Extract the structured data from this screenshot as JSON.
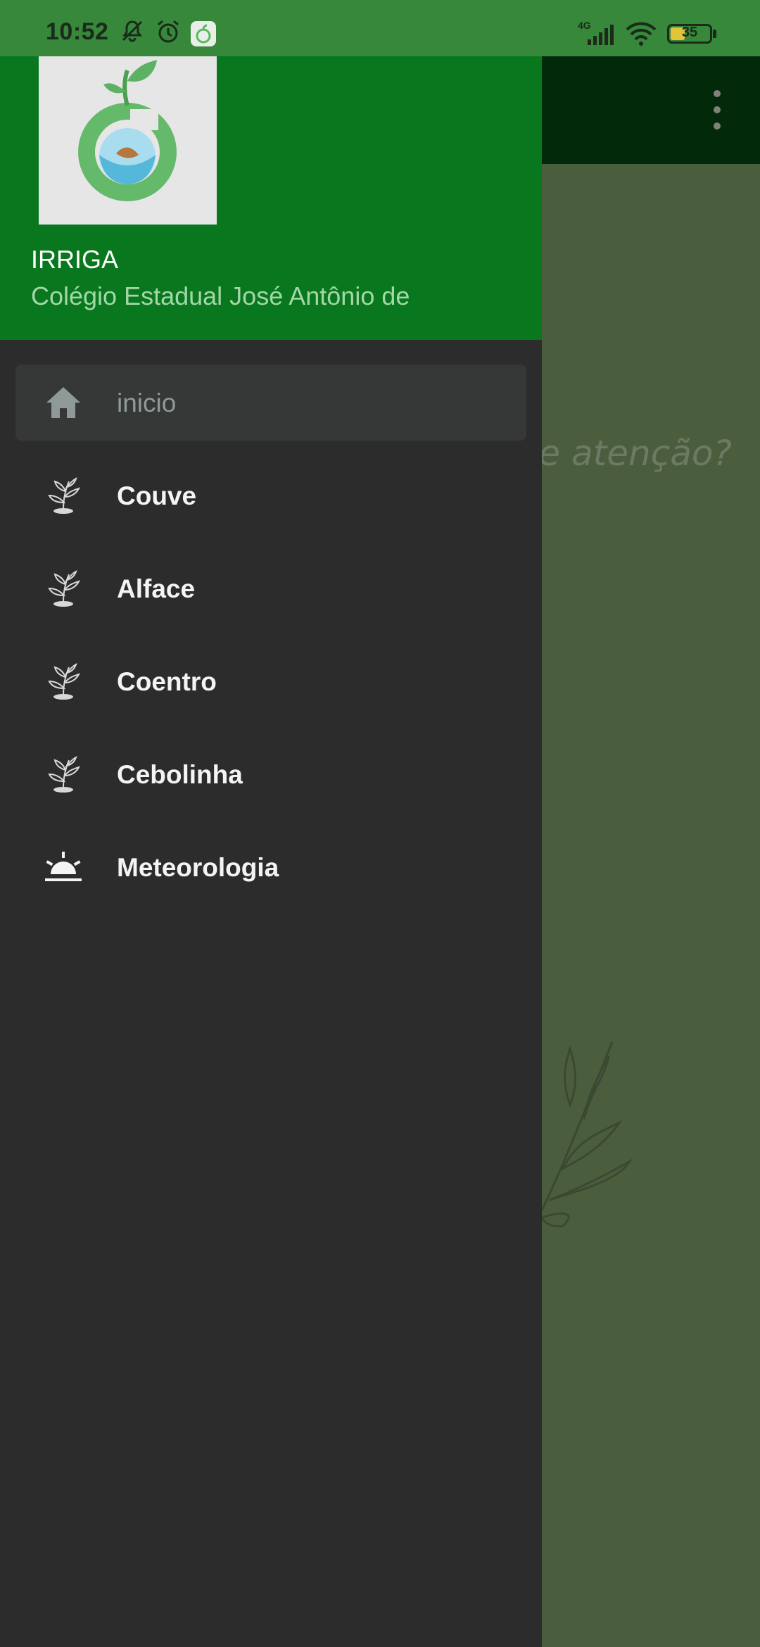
{
  "status_bar": {
    "time": "10:52",
    "network": "4G",
    "battery": "35",
    "icons": [
      "dnd-off-icon",
      "alarm-icon",
      "app-notification-icon",
      "signal-icon",
      "wifi-icon",
      "battery-icon"
    ]
  },
  "main": {
    "question_fragment": "de atenção?",
    "menu_icon": "overflow-menu-icon"
  },
  "drawer": {
    "header": {
      "title": "IRRIGA",
      "subtitle": "Colégio Estadual José Antônio de"
    },
    "items": [
      {
        "label": "inicio",
        "icon": "home-icon",
        "selected": true
      },
      {
        "label": "Couve",
        "icon": "plant-icon",
        "selected": false
      },
      {
        "label": "Alface",
        "icon": "plant-icon",
        "selected": false
      },
      {
        "label": "Coentro",
        "icon": "plant-icon",
        "selected": false
      },
      {
        "label": "Cebolinha",
        "icon": "plant-icon",
        "selected": false
      },
      {
        "label": "Meteorologia",
        "icon": "sunrise-icon",
        "selected": false
      }
    ]
  },
  "colors": {
    "status_bar": "#37883a",
    "drawer_header": "#08771e",
    "drawer_bg": "#2c2c2c",
    "main_bg": "#4a5e3e",
    "toolbar": "#022a0a"
  }
}
